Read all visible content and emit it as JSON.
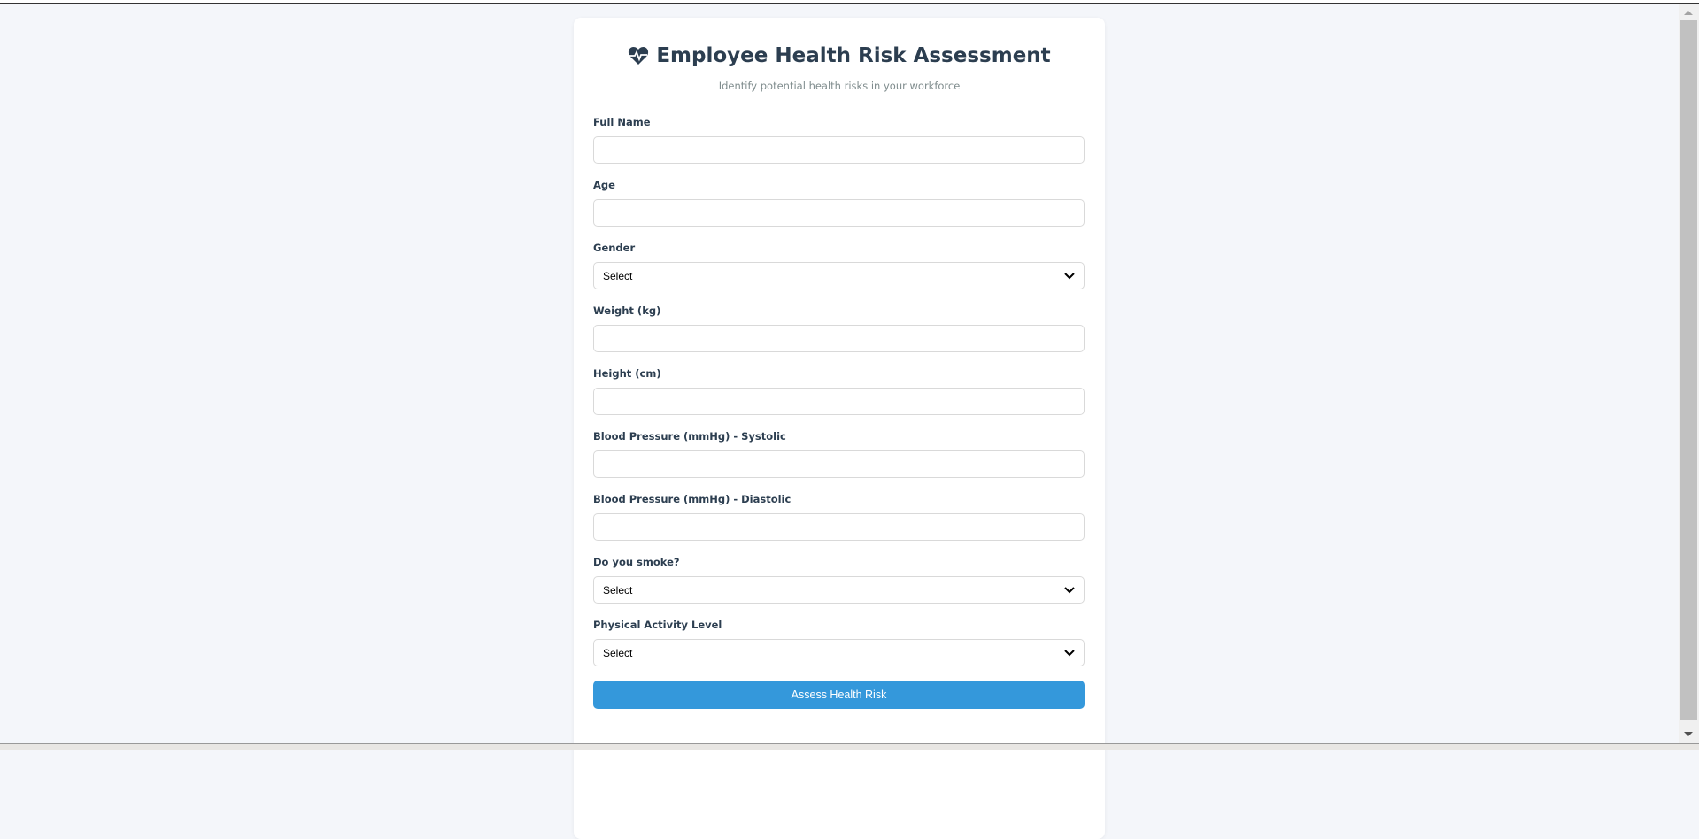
{
  "header": {
    "title": "Employee Health Risk Assessment",
    "subtitle": "Identify potential health risks in your workforce",
    "icon": "heartbeat-icon"
  },
  "form": {
    "fields": [
      {
        "label": "Full Name",
        "type": "text",
        "value": ""
      },
      {
        "label": "Age",
        "type": "number",
        "value": ""
      },
      {
        "label": "Gender",
        "type": "select",
        "value": "Select"
      },
      {
        "label": "Weight (kg)",
        "type": "number",
        "value": ""
      },
      {
        "label": "Height (cm)",
        "type": "number",
        "value": ""
      },
      {
        "label": "Blood Pressure (mmHg) - Systolic",
        "type": "number",
        "value": ""
      },
      {
        "label": "Blood Pressure (mmHg) - Diastolic",
        "type": "number",
        "value": ""
      },
      {
        "label": "Do you smoke?",
        "type": "select",
        "value": "Select"
      },
      {
        "label": "Physical Activity Level",
        "type": "select",
        "value": "Select"
      }
    ],
    "submit_label": "Assess Health Risk"
  },
  "colors": {
    "accent": "#3498db",
    "heading": "#2c3e50",
    "background": "#f4f6fa"
  }
}
